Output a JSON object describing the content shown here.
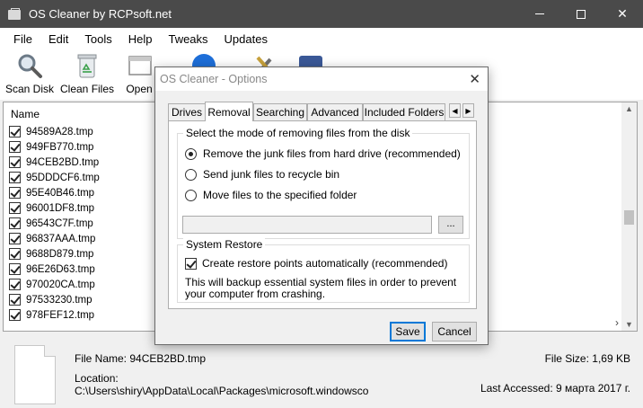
{
  "window": {
    "title": "OS Cleaner by RCPsoft.net",
    "controls": {
      "minimize": "—",
      "maximize": "☐",
      "close": "✕"
    }
  },
  "menu": [
    "File",
    "Edit",
    "Tools",
    "Help",
    "Tweaks",
    "Updates"
  ],
  "toolbar": {
    "scan_disk": "Scan Disk",
    "clean_files": "Clean Files",
    "open": "Open"
  },
  "file_list": {
    "column_name": "Name",
    "rows": [
      "94589A28.tmp",
      "949FB770.tmp",
      "94CEB2BD.tmp",
      "95DDDCF6.tmp",
      "95E40B46.tmp",
      "96001DF8.tmp",
      "96543C7F.tmp",
      "96837AAA.tmp",
      "9688D879.tmp",
      "96E26D63.tmp",
      "970020CA.tmp",
      "97533230.tmp",
      "978FEF12.tmp"
    ]
  },
  "details": {
    "file_name_label": "File Name:",
    "file_name": "94CEB2BD.tmp",
    "location_label": "Location:",
    "location": "C:\\Users\\shiry\\AppData\\Local\\Packages\\microsoft.windowsco",
    "file_size_label": "File Size:",
    "file_size": "1,69 KB",
    "last_accessed_label": "Last Accessed:",
    "last_accessed": "9 марта 2017 г."
  },
  "dialog": {
    "title": "OS Cleaner - Options",
    "close": "✕",
    "tabs": [
      "Drives",
      "Removal",
      "Searching",
      "Advanced",
      "Included Folders"
    ],
    "active_tab": "Removal",
    "tab_scroll_left": "◀",
    "tab_scroll_right": "▶",
    "removal_group": {
      "title": "Select the mode of removing files from the disk",
      "options": [
        "Remove the junk files from hard drive (recommended)",
        "Send junk files to recycle bin",
        "Move files to the specified folder"
      ],
      "selected_index": 0,
      "folder_path_value": "",
      "browse_label": "..."
    },
    "restore_group": {
      "title": "System Restore",
      "checkbox_label": "Create restore points automatically (recommended)",
      "checked": true,
      "hint": "This will backup essential system files in order to prevent your computer from crashing."
    },
    "save": "Save",
    "cancel": "Cancel"
  },
  "colors": {
    "titlebar": "#4a4a4a",
    "accent": "#0078d7",
    "facebook": "#3b5998",
    "info_icon": "#1e6fd9"
  }
}
